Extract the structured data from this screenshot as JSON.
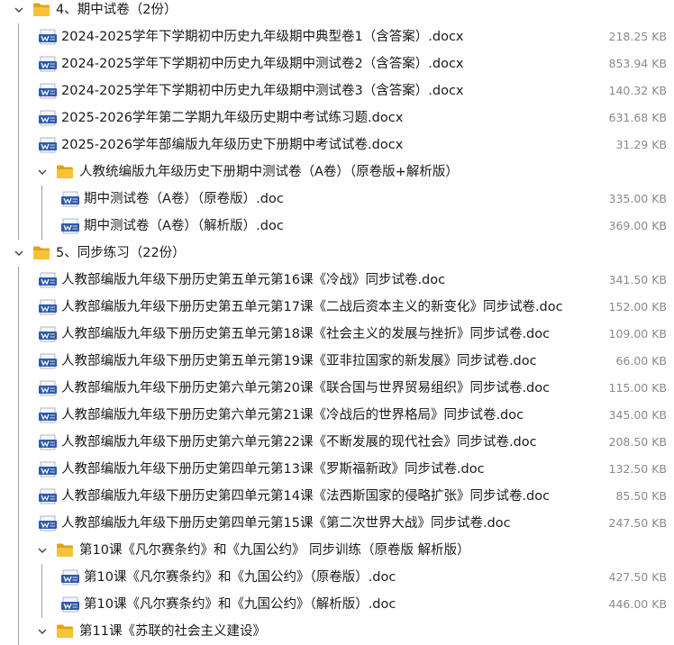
{
  "colors": {
    "folder": "#F6C236",
    "folder_dark": "#DFA21A",
    "doc_blue": "#2F5AA8",
    "size_text": "#8a8a8a",
    "guide": "#a0a0a0"
  },
  "icons": {
    "expand": "chevron-down-icon",
    "folder": "folder-icon",
    "file": "word-doc-icon"
  },
  "rows": [
    {
      "kind": "folder",
      "level": 0,
      "name": "4、期中试卷（2份）",
      "size": ""
    },
    {
      "kind": "file",
      "level": 1,
      "name": "2024-2025学年下学期初中历史九年级期中典型卷1（含答案）.docx",
      "size": "218.25 KB"
    },
    {
      "kind": "file",
      "level": 1,
      "name": "2024-2025学年下学期初中历史九年级期中测试卷2（含答案）.docx",
      "size": "853.94 KB"
    },
    {
      "kind": "file",
      "level": 1,
      "name": "2024-2025学年下学期初中历史九年级期中测试卷3（含答案）.docx",
      "size": "140.32 KB"
    },
    {
      "kind": "file",
      "level": 1,
      "name": "2025-2026学年第二学期九年级历史期中考试练习题.docx",
      "size": "631.68 KB"
    },
    {
      "kind": "file",
      "level": 1,
      "name": "2025-2026学年部编版九年级历史下册期中考试试卷.docx",
      "size": "31.29 KB"
    },
    {
      "kind": "folder",
      "level": 1,
      "name": "人教统编版九年级历史下册期中测试卷（A卷）（原卷版+解析版）",
      "size": ""
    },
    {
      "kind": "file",
      "level": 2,
      "name": "期中测试卷（A卷）（原卷版）.doc",
      "size": "335.00 KB"
    },
    {
      "kind": "file",
      "level": 2,
      "name": "期中测试卷（A卷）（解析版）.doc",
      "size": "369.00 KB"
    },
    {
      "kind": "folder",
      "level": 0,
      "name": "5、同步练习（22份）",
      "size": ""
    },
    {
      "kind": "file",
      "level": 1,
      "name": "人教部编版九年级下册历史第五单元第16课《冷战》同步试卷.doc",
      "size": "341.50 KB"
    },
    {
      "kind": "file",
      "level": 1,
      "name": "人教部编版九年级下册历史第五单元第17课《二战后资本主义的新变化》同步试卷.doc",
      "size": "152.00 KB"
    },
    {
      "kind": "file",
      "level": 1,
      "name": "人教部编版九年级下册历史第五单元第18课《社会主义的发展与挫折》同步试卷.doc",
      "size": "109.00 KB"
    },
    {
      "kind": "file",
      "level": 1,
      "name": "人教部编版九年级下册历史第五单元第19课《亚非拉国家的新发展》同步试卷.doc",
      "size": "66.00 KB"
    },
    {
      "kind": "file",
      "level": 1,
      "name": "人教部编版九年级下册历史第六单元第20课《联合国与世界贸易组织》同步试卷.doc",
      "size": "115.00 KB"
    },
    {
      "kind": "file",
      "level": 1,
      "name": "人教部编版九年级下册历史第六单元第21课《冷战后的世界格局》同步试卷.doc",
      "size": "345.00 KB"
    },
    {
      "kind": "file",
      "level": 1,
      "name": "人教部编版九年级下册历史第六单元第22课《不断发展的现代社会》同步试卷.doc",
      "size": "208.50 KB"
    },
    {
      "kind": "file",
      "level": 1,
      "name": "人教部编版九年级下册历史第四单元第13课《罗斯福新政》同步试卷.doc",
      "size": "132.50 KB"
    },
    {
      "kind": "file",
      "level": 1,
      "name": "人教部编版九年级下册历史第四单元第14课《法西斯国家的侵略扩张》同步试卷.doc",
      "size": "85.50 KB"
    },
    {
      "kind": "file",
      "level": 1,
      "name": "人教部编版九年级下册历史第四单元第15课《第二次世界大战》同步试卷.doc",
      "size": "247.50 KB"
    },
    {
      "kind": "folder",
      "level": 1,
      "name": "第10课《凡尔赛条约》和《九国公约》 同步训练（原卷版 解析版）",
      "size": ""
    },
    {
      "kind": "file",
      "level": 2,
      "name": "第10课《凡尔赛条约》和《九国公约》（原卷版）.doc",
      "size": "427.50 KB"
    },
    {
      "kind": "file",
      "level": 2,
      "name": "第10课《凡尔赛条约》和《九国公约》（解析版）.doc",
      "size": "446.00 KB"
    },
    {
      "kind": "folder",
      "level": 1,
      "name": "第11课《苏联的社会主义建设》",
      "size": ""
    }
  ]
}
